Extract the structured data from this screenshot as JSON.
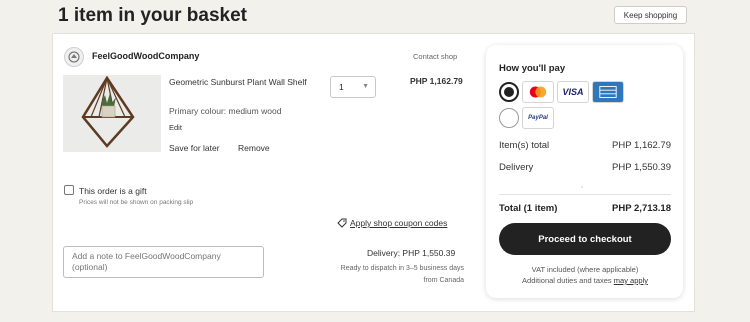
{
  "header": {
    "title": "1 item in your basket",
    "keep_shopping": "Keep shopping"
  },
  "shop": {
    "name": "FeelGoodWoodCompany",
    "contact": "Contact shop"
  },
  "item": {
    "title": "Geometric Sunburst Plant Wall Shelf",
    "variant": "Primary colour: medium wood",
    "edit": "Edit",
    "save_for_later": "Save for later",
    "remove": "Remove",
    "quantity": "1",
    "price": "PHP 1,162.79"
  },
  "gift": {
    "label": "This order is a gift",
    "note": "Prices will not be shown on packing slip"
  },
  "coupon": {
    "label": "Apply shop coupon codes"
  },
  "note": {
    "placeholder": "Add a note to FeelGoodWoodCompany (optional)"
  },
  "delivery": {
    "label": "Delivery: PHP 1,550.39",
    "dispatch_line1": "Ready to dispatch in 3–5 business days",
    "dispatch_line2": "from Canada"
  },
  "payment": {
    "title": "How you'll pay",
    "methods": [
      {
        "name": "card",
        "selected": true,
        "logos": [
          "mastercard",
          "VISA",
          "amex"
        ]
      },
      {
        "name": "paypal",
        "selected": false,
        "logos": [
          "PayPal"
        ]
      }
    ],
    "visa_text": "VISA",
    "paypal_text": "PayPal"
  },
  "summary": {
    "items_label": "Item(s) total",
    "items_value": "PHP 1,162.79",
    "delivery_label": "Delivery",
    "delivery_value": "PHP 1,550.39",
    "total_label": "Total (1 item)",
    "total_value": "PHP 2,713.18",
    "checkout": "Proceed to checkout",
    "vat_note": "VAT included (where applicable)",
    "duties_note": "Additional duties and taxes",
    "duties_link": "may apply"
  },
  "colors": {
    "background": "#f3f1ec",
    "primary_button": "#222222",
    "mastercard_red": "#eb001b",
    "mastercard_orange": "#f79e1b",
    "visa_blue": "#1a1f71",
    "amex_blue": "#2e77bc",
    "paypal_blue": "#253b80"
  }
}
